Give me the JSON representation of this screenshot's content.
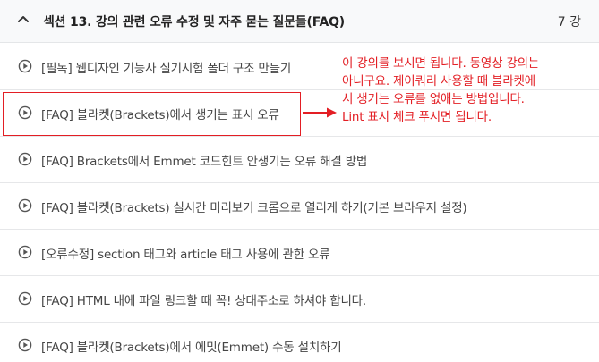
{
  "section": {
    "title": "섹션 13. 강의 관련 오류 수정 및 자주 묻는 질문들(FAQ)",
    "count": "7 강",
    "chevron_icon": "chevron-up-icon"
  },
  "lectures": [
    {
      "title": "[필독] 웹디자인 기능사 실기시험 폴더 구조 만들기",
      "icon": "play-circle-icon"
    },
    {
      "title": "[FAQ] 블라켓(Brackets)에서 생기는 표시 오류",
      "icon": "play-circle-icon"
    },
    {
      "title": "[FAQ] Brackets에서 Emmet 코드힌트 안생기는 오류 해결 방법",
      "icon": "play-circle-icon"
    },
    {
      "title": "[FAQ] 블라켓(Brackets) 실시간 미리보기 크롬으로 열리게 하기(기본 브라우저 설정)",
      "icon": "play-circle-icon"
    },
    {
      "title": "[오류수정] section 태그와 article 태그 사용에 관한 오류",
      "icon": "play-circle-icon"
    },
    {
      "title": "[FAQ] HTML 내에 파일 링크할 때 꼭! 상대주소로 하셔야 합니다.",
      "icon": "play-circle-icon"
    },
    {
      "title": "[FAQ] 블라켓(Brackets)에서 에밋(Emmet) 수동 설치하기",
      "icon": "play-circle-icon"
    }
  ],
  "annotation": {
    "lines": [
      "이 강의를 보시면 됩니다. 동영상 강의는",
      "아니구요. 제이쿼리 사용할 때 블라켓에",
      "서 생기는 오류를 없애는 방법입니다.",
      "Lint 표시 체크 푸시면 됩니다."
    ]
  },
  "colors": {
    "annotation": "#e31e24",
    "header_bg": "#f8f9fa",
    "text": "#454545"
  }
}
